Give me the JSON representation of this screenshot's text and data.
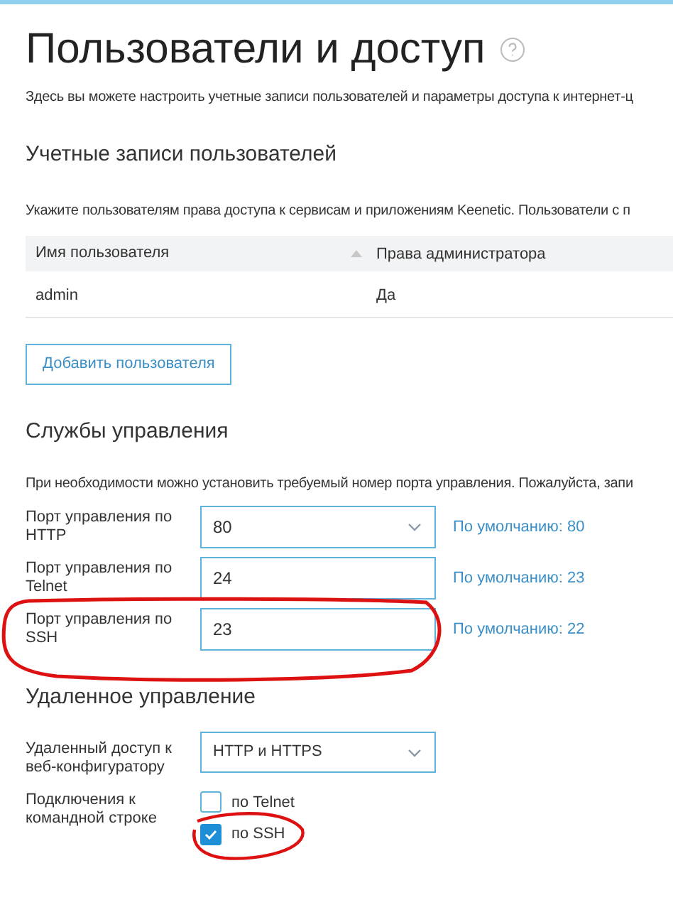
{
  "title": "Пользователи и доступ",
  "intro": "Здесь вы можете настроить учетные записи пользователей и параметры доступа к интернет-ц",
  "users": {
    "heading": "Учетные записи пользователей",
    "description": "Укажите пользователям права доступа к сервисам и приложениям Keenetic. Пользователи с п",
    "columns": [
      {
        "label": "Имя пользователя",
        "sorted": true
      },
      {
        "label": "Права администратора",
        "sorted": false
      }
    ],
    "rows": [
      [
        "admin",
        "Да"
      ]
    ],
    "add_button": "Добавить пользователя"
  },
  "services": {
    "heading": "Службы управления",
    "description": "При необходимости можно установить требуемый номер порта управления. Пожалуйста, запи",
    "fields": [
      {
        "label": "Порт управления по HTTP",
        "kind": "select",
        "value": "80",
        "default": "По умолчанию: 80"
      },
      {
        "label": "Порт управления по Telnet",
        "kind": "input",
        "value": "24",
        "default": "По умолчанию: 23"
      },
      {
        "label": "Порт управления по SSH",
        "kind": "input",
        "value": "23",
        "default": "По умолчанию: 22"
      }
    ]
  },
  "remote": {
    "heading": "Удаленное управление",
    "web_access": {
      "label": "Удаленный доступ к веб-конфигуратору",
      "value": "HTTP и HTTPS"
    },
    "cli": {
      "label": "Подключения к командной строке",
      "options": [
        {
          "label": "по Telnet",
          "checked": false
        },
        {
          "label": "по SSH",
          "checked": true
        }
      ]
    }
  }
}
